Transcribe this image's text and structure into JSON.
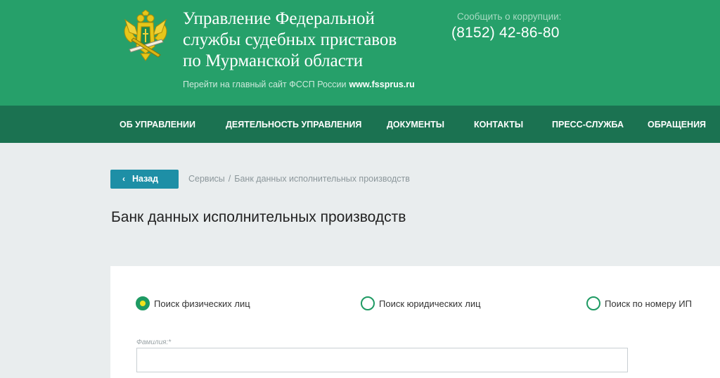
{
  "header": {
    "org_name_line1": "Управление Федеральной",
    "org_name_line2": "службы судебных приставов",
    "org_name_line3": "по Мурманской области",
    "main_site_text": "Перейти на главный сайт ФССП России",
    "main_site_link": "www.fssprus.ru",
    "corruption_label": "Сообщить о коррупции:",
    "corruption_phone": "(8152) 42-86-80",
    "emblem_icon": "double-headed-eagle-emblem-icon"
  },
  "nav": {
    "items": [
      "ОБ УПРАВЛЕНИИ",
      "ДЕЯТЕЛЬНОСТЬ УПРАВЛЕНИЯ",
      "ДОКУМЕНТЫ",
      "КОНТАКТЫ",
      "ПРЕСС-СЛУЖБА",
      "ОБРАЩЕНИЯ"
    ]
  },
  "breadcrumb": {
    "back_label": "Назад",
    "back_icon": "chevron-left-icon",
    "items": [
      "Сервисы",
      "Банк данных исполнительных производств"
    ],
    "separator": "/"
  },
  "page": {
    "title": "Банк данных исполнительных производств"
  },
  "search": {
    "options": [
      {
        "label": "Поиск физических лиц",
        "selected": true
      },
      {
        "label": "Поиск юридических лиц",
        "selected": false
      },
      {
        "label": "Поиск по номеру ИП",
        "selected": false
      }
    ],
    "lastname_label": "Фамилия:*",
    "lastname_value": ""
  },
  "colors": {
    "header_bg": "#26a06a",
    "nav_bg": "#1b7251",
    "back_button_bg": "#1e8fa6",
    "page_bg": "#e9edee",
    "radio_accent": "#1e9a63",
    "radio_dot": "#f2e21c"
  }
}
